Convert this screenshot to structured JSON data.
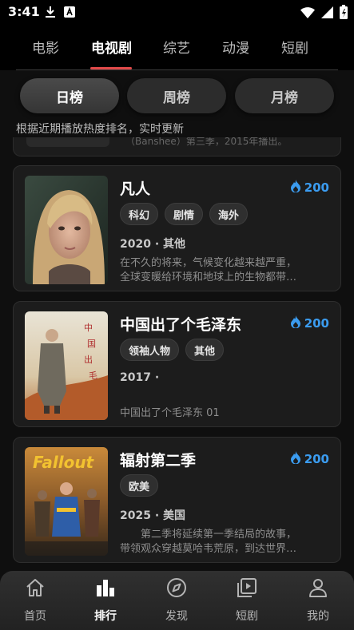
{
  "status_bar": {
    "time": "3:41"
  },
  "category_tabs": [
    {
      "label": "电影",
      "active": false
    },
    {
      "label": "电视剧",
      "active": true
    },
    {
      "label": "综艺",
      "active": false
    },
    {
      "label": "动漫",
      "active": false
    },
    {
      "label": "短剧",
      "active": false
    }
  ],
  "period_tabs": [
    {
      "label": "日榜",
      "active": true
    },
    {
      "label": "周榜",
      "active": false
    },
    {
      "label": "月榜",
      "active": false
    }
  ],
  "ranking_note": "根据近期播放热度排名，实时更新",
  "previous_card_snippet": "（Banshee）第三季，2015年播出。",
  "shows": [
    {
      "title": "凡人",
      "heat": "200",
      "tags": [
        "科幻",
        "剧情",
        "海外"
      ],
      "meta": "2020 · 其他",
      "desc_line1": "在不久的将来，气候变化越来越严重，",
      "desc_line2": "全球变暖给环境和地球上的生物都带…"
    },
    {
      "title": "中国出了个毛泽东",
      "heat": "200",
      "tags": [
        "领袖人物",
        "其他"
      ],
      "meta": "2017 ·",
      "desc_line1": "中国出了个毛泽东 01",
      "desc_line2": ""
    },
    {
      "title": "辐射第二季",
      "heat": "200",
      "tags": [
        "欧美"
      ],
      "meta": "2025 · 美国",
      "desc_line1": "　　第二季将延续第一季结局的故事，",
      "desc_line2": "带领观众穿越莫哈韦荒原，到达世界…"
    }
  ],
  "bottom_nav": [
    {
      "label": "首页",
      "icon": "home-icon",
      "active": false
    },
    {
      "label": "排行",
      "icon": "ranking-icon",
      "active": true
    },
    {
      "label": "发现",
      "icon": "compass-icon",
      "active": false
    },
    {
      "label": "短剧",
      "icon": "play-list-icon",
      "active": false
    },
    {
      "label": "我的",
      "icon": "person-icon",
      "active": false
    }
  ],
  "colors": {
    "accent_underline": "#e24a4a",
    "heat_blue": "#3b9cf0",
    "background": "#0f0f0f",
    "card": "#1c1c1c"
  }
}
